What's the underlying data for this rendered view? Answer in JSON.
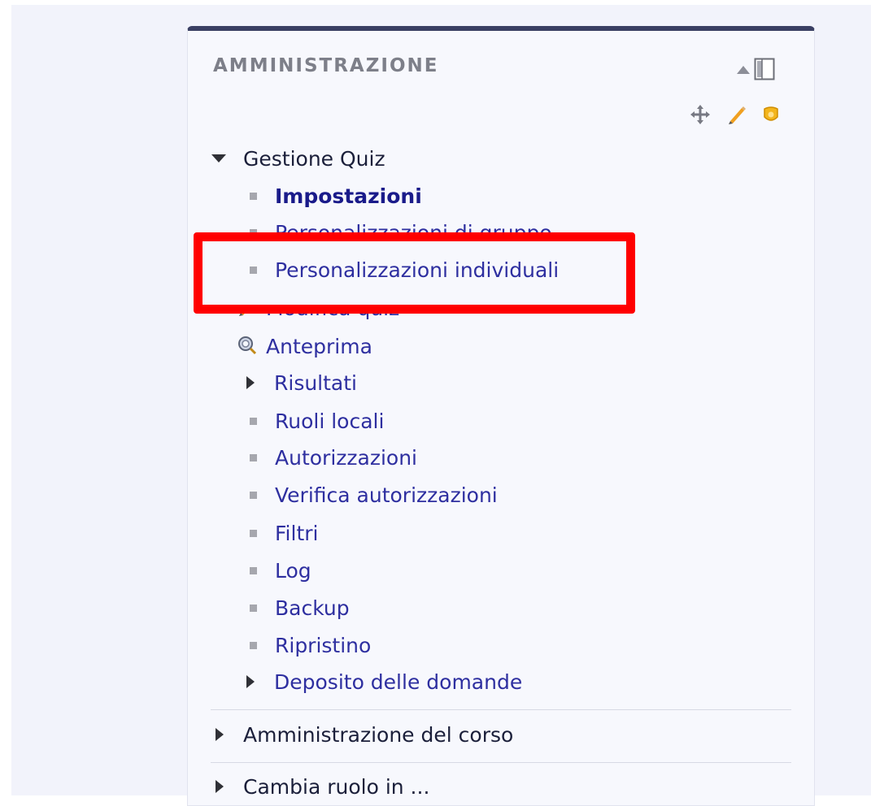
{
  "block": {
    "title": "AMMINISTRAZIONE",
    "controls": {
      "collapse_icon": "collapse-up-icon",
      "dock_icon": "dock-icon",
      "move_icon": "move-icon",
      "edit_icon": "pencil-icon",
      "assign_icon": "assign-roles-icon"
    }
  },
  "tree": {
    "gestione_quiz": "Gestione Quiz",
    "items": [
      "Impostazioni",
      "Personalizzazioni di gruppo",
      "Personalizzazioni individuali",
      "Modifica quiz",
      "Anteprima",
      "Risultati",
      "Ruoli locali",
      "Autorizzazioni",
      "Verifica autorizzazioni",
      "Filtri",
      "Log",
      "Backup",
      "Ripristino",
      "Deposito delle domande"
    ],
    "amministrazione_corso": "Amministrazione del corso",
    "cambia_ruolo": "Cambia ruolo in ..."
  },
  "colors": {
    "header_bar": "#3a3f63",
    "link": "#2e2fa0",
    "highlight": "#ff0000"
  }
}
